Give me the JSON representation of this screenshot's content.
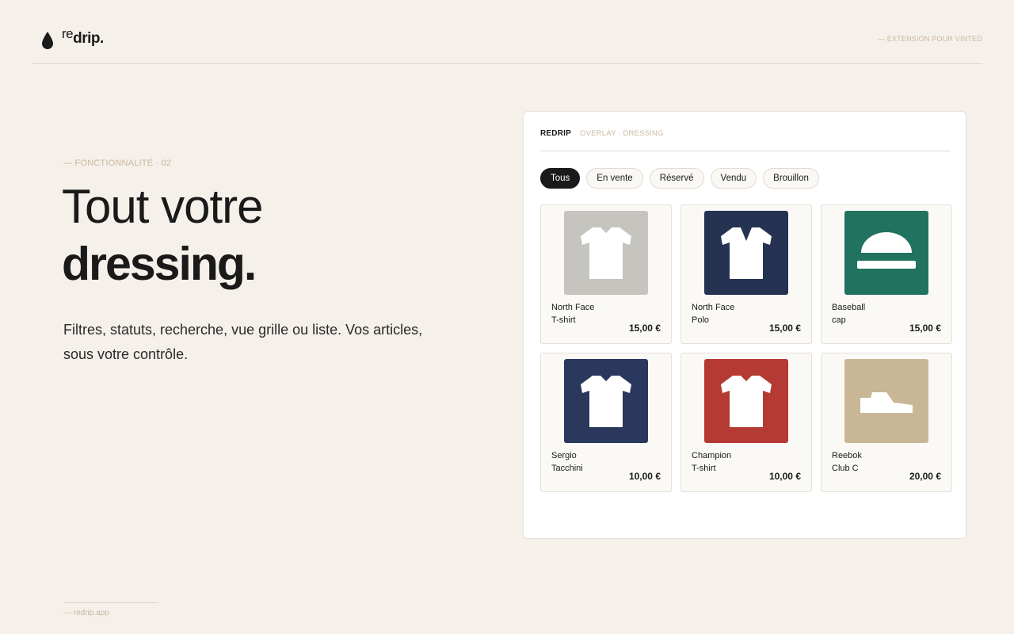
{
  "header": {
    "logo_re": "re",
    "logo_drip": "drip.",
    "tag": "— EXTENSION POUR VINTED"
  },
  "hero": {
    "kicker": "— FONCTIONNALITÉ · 02",
    "title_light": "Tout votre",
    "title_bold": "dressing.",
    "description": "Filtres, statuts, recherche, vue grille ou liste. Vos articles, sous votre contrôle."
  },
  "footer": {
    "site": "— redrip.app"
  },
  "panel": {
    "brand": "REDRIP",
    "subtitle": "OVERLAY · DRESSING",
    "filters": [
      {
        "label": "Tous",
        "active": true
      },
      {
        "label": "En vente",
        "active": false
      },
      {
        "label": "Réservé",
        "active": false
      },
      {
        "label": "Vendu",
        "active": false
      },
      {
        "label": "Brouillon",
        "active": false
      }
    ],
    "items": [
      {
        "line1": "North Face",
        "line2": "T-shirt",
        "price": "15,00 €",
        "icon": "tshirt-icon",
        "color": "#c5c4bf"
      },
      {
        "line1": "North Face",
        "line2": "Polo",
        "price": "15,00 €",
        "icon": "polo-icon",
        "color": "#263252"
      },
      {
        "line1": "Baseball",
        "line2": "cap",
        "price": "15,00 €",
        "icon": "cap-icon",
        "color": "#227260"
      },
      {
        "line1": "Sergio",
        "line2": "Tacchini",
        "price": "10,00 €",
        "icon": "tshirt-icon",
        "color": "#2a385d"
      },
      {
        "line1": "Champion",
        "line2": "T-shirt",
        "price": "10,00 €",
        "icon": "tshirt-icon",
        "color": "#b43a33"
      },
      {
        "line1": "Reebok",
        "line2": "Club C",
        "price": "20,00 €",
        "icon": "sneaker-icon",
        "color": "#c8b697"
      }
    ]
  },
  "colors": {
    "background": "#f5f0ea",
    "accent": "#c9b89f",
    "ink": "#1a1a1a"
  }
}
